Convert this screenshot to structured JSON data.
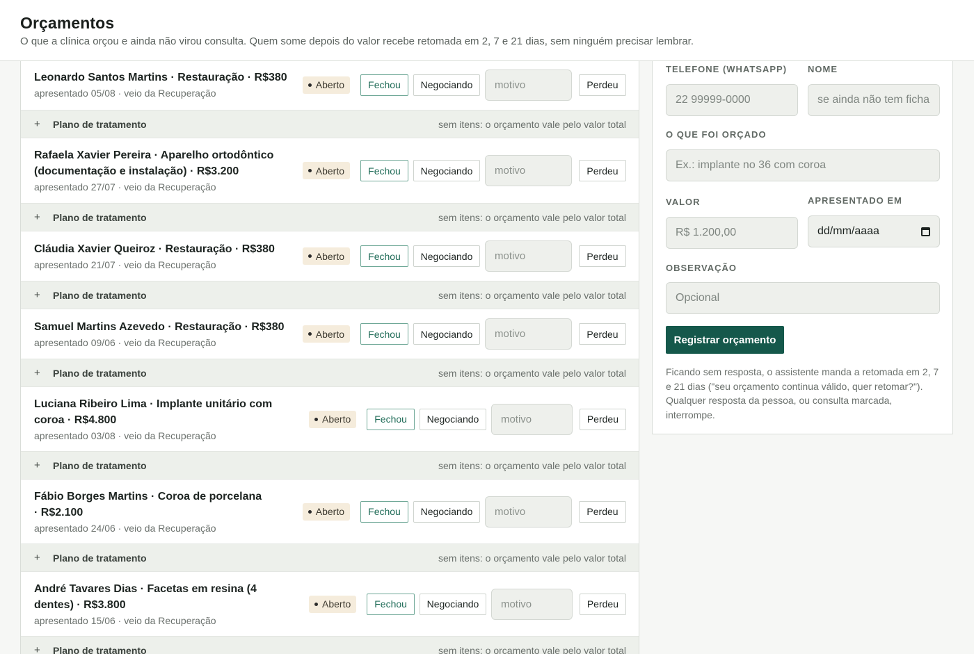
{
  "header": {
    "title": "Orçamentos",
    "subtitle": "O que a clínica orçou e ainda não virou consulta. Quem some depois do valor recebe retomada em 2, 7 e 21 dias, sem ninguém precisar lembrar."
  },
  "actions": {
    "badge": "Aberto",
    "fechou": "Fechou",
    "negociando": "Negociando",
    "motivo_placeholder": "motivo",
    "perdeu": "Perdeu"
  },
  "plan": {
    "plus": "+",
    "label": "Plano de tratamento",
    "hint": "sem itens: o orçamento vale pelo valor total"
  },
  "quotes": [
    {
      "title": "Leonardo Santos Martins · Restauração · R$380",
      "meta": "apresentado 05/08 · veio da Recuperação"
    },
    {
      "title": "Rafaela Xavier Pereira · Aparelho ortodôntico (documentação e instalação) · R$3.200",
      "meta": "apresentado 27/07 · veio da Recuperação"
    },
    {
      "title": "Cláudia Xavier Queiroz · Restauração · R$380",
      "meta": "apresentado 21/07 · veio da Recuperação"
    },
    {
      "title": "Samuel Martins Azevedo · Restauração · R$380",
      "meta": "apresentado 09/06 · veio da Recuperação"
    },
    {
      "title": "Luciana Ribeiro Lima · Implante unitário com coroa · R$4.800",
      "meta": "apresentado 03/08 · veio da Recuperação"
    },
    {
      "title": "Fábio Borges Martins · Coroa de porcelana · R$2.100",
      "meta": "apresentado 24/06 · veio da Recuperação"
    },
    {
      "title": "André Tavares Dias · Facetas em resina (4 dentes) · R$3.800",
      "meta": "apresentado 15/06 · veio da Recuperação"
    }
  ],
  "form": {
    "phone_label": "Telefone (WhatsApp)",
    "phone_placeholder": "22 99999-0000",
    "name_label": "Nome",
    "name_placeholder": "se ainda não tem ficha",
    "what_label": "O que foi orçado",
    "what_placeholder": "Ex.: implante no 36 com coroa",
    "value_label": "Valor",
    "value_placeholder": "R$ 1.200,00",
    "date_label": "Apresentado em",
    "date_value": "dd/mm/aaaa",
    "obs_label": "Observação",
    "obs_placeholder": "Opcional",
    "submit": "Registrar orçamento",
    "note": "Ficando sem resposta, o assistente manda a retomada em 2, 7 e 21 dias (\"seu orçamento continua válido, quer retomar?\"). Qualquer resposta da pessoa, ou consulta marcada, interrompe."
  }
}
